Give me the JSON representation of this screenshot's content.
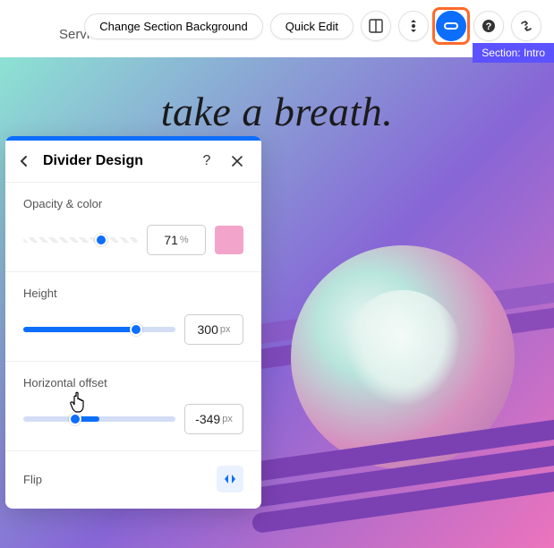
{
  "nav": {
    "services": "Services"
  },
  "toolbar": {
    "change_bg": "Change Section Background",
    "quick_edit": "Quick Edit"
  },
  "section_tag": "Section: Intro",
  "headline": "take a breath.",
  "panel": {
    "title": "Divider Design",
    "opacity": {
      "label": "Opacity & color",
      "value": "71",
      "unit": "%",
      "swatch": "#f3a4ca",
      "slider_pct": 68
    },
    "height": {
      "label": "Height",
      "value": "300",
      "unit": "px",
      "slider_pct": 74
    },
    "hoffset": {
      "label": "Horizontal offset",
      "value": "-349",
      "unit": "px",
      "slider_pct": 34,
      "fill_start_pct": 34,
      "fill_end_pct": 50
    },
    "flip": {
      "label": "Flip"
    }
  }
}
